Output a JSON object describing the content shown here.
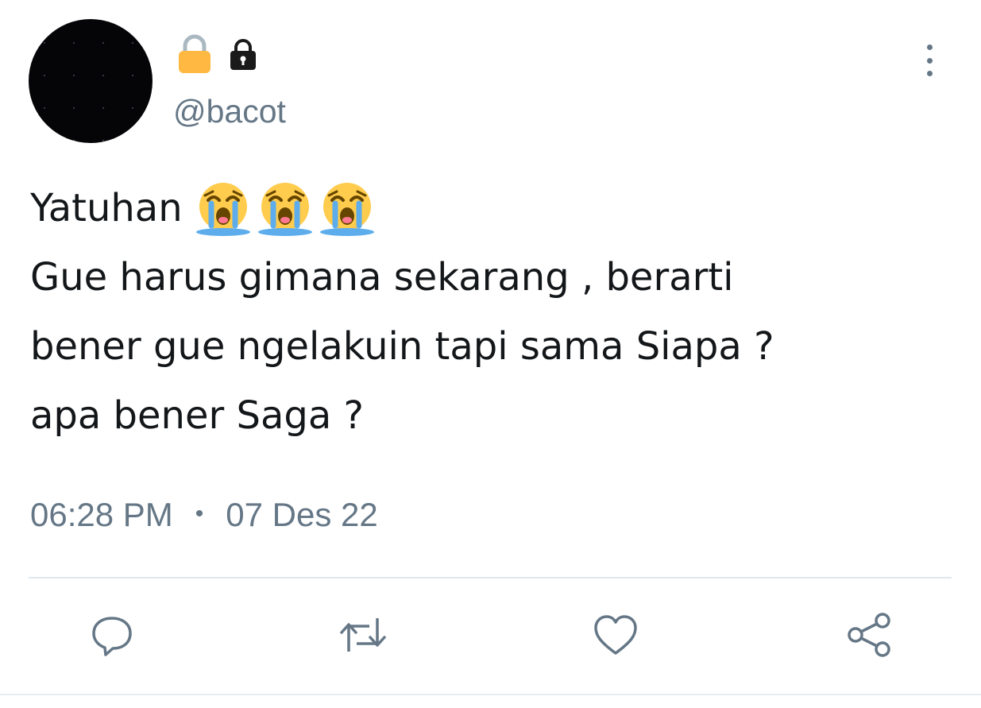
{
  "profile": {
    "handle": "@bacot",
    "name_icons": [
      "lock-yellow-icon",
      "lock-black-icon"
    ]
  },
  "tweet": {
    "line1_text": "Yatuhan",
    "line1_emoji": [
      "loudly-crying-face-icon",
      "loudly-crying-face-icon",
      "loudly-crying-face-icon"
    ],
    "lines": [
      "Gue harus gimana sekarang , berarti",
      "bener gue ngelakuin tapi sama Siapa ?",
      "apa bener Saga ?"
    ],
    "time": "06:28 PM",
    "separator": "•",
    "date": "07 Des 22"
  },
  "actions": {
    "icons": [
      "reply-icon",
      "retweet-icon",
      "like-icon",
      "share-icon"
    ]
  },
  "colors": {
    "text_primary": "#14171a",
    "text_secondary": "#657786",
    "divider": "#e1e8ed",
    "lock_yellow": "#ffb942"
  }
}
